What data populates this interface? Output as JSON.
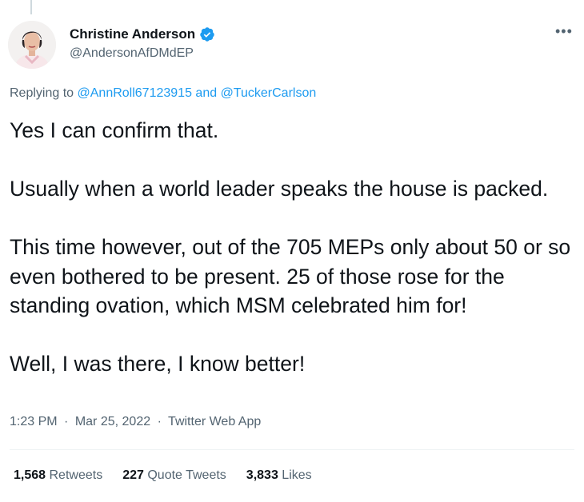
{
  "tweet": {
    "author": {
      "display_name": "Christine Anderson",
      "handle": "@AndersonAfDMdEP",
      "verified": true
    },
    "replying": {
      "prefix": "Replying to ",
      "user1": "@AnnRoll67123915",
      "conjunction": " and ",
      "user2": "@TuckerCarlson"
    },
    "text": {
      "p1": "Yes I can confirm that.",
      "p2": "Usually when a world leader speaks the house is packed.",
      "p3": "This time however, out of the 705 MEPs only about 50 or so even bothered to be present. 25 of those rose for the standing ovation, which MSM celebrated him for!",
      "p4": "Well, I was there, I know better!"
    },
    "meta": {
      "time": "1:23 PM",
      "separator": "·",
      "date": "Mar 25, 2022",
      "source": "Twitter Web App"
    },
    "stats": {
      "retweets_count": "1,568",
      "retweets_label": "Retweets",
      "quotes_count": "227",
      "quotes_label": "Quote Tweets",
      "likes_count": "3,833",
      "likes_label": "Likes"
    }
  },
  "icons": {
    "verified": "verified-badge-icon",
    "more": "more-icon"
  },
  "colors": {
    "link": "#1d9bf0",
    "secondary_text": "#536471",
    "primary_text": "#0f1419"
  }
}
